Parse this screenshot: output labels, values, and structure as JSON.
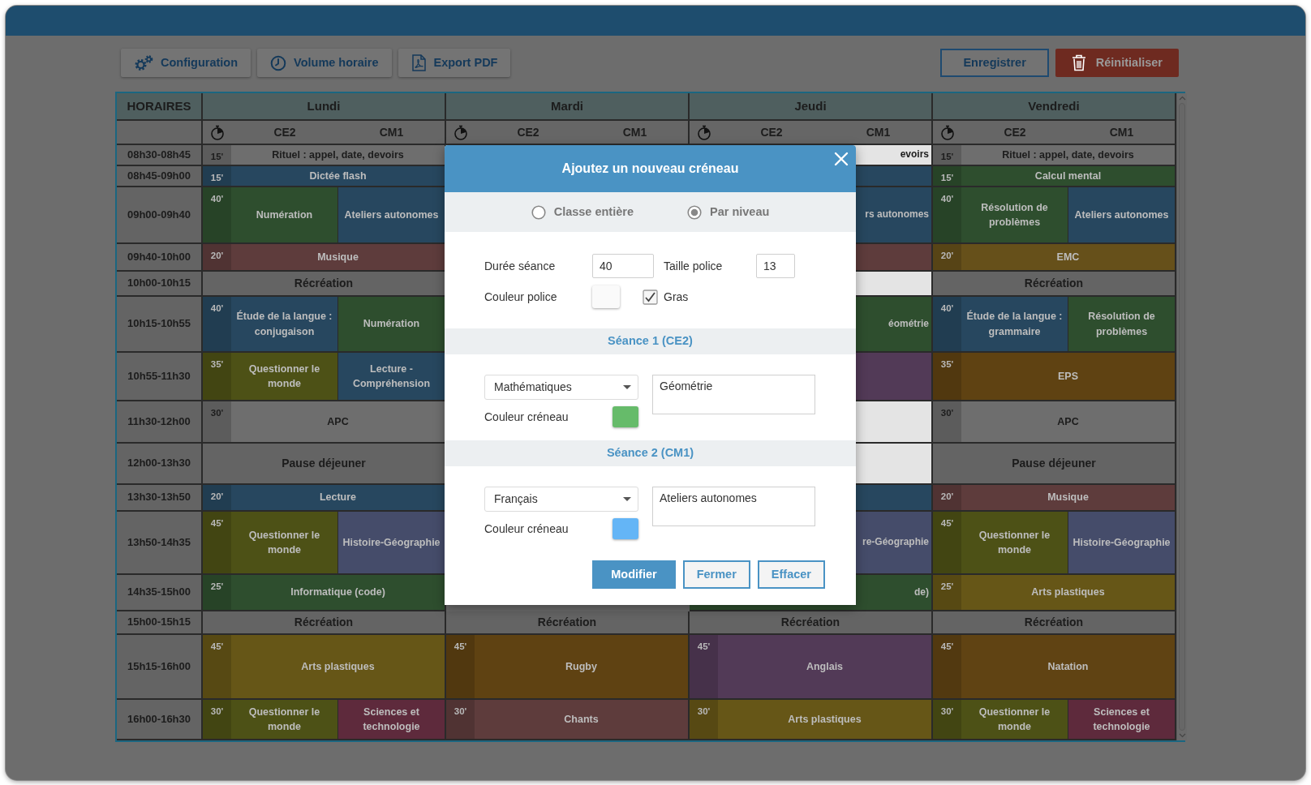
{
  "toolbar": {
    "buttons": [
      {
        "label": "Configuration"
      },
      {
        "label": "Volume horaire"
      },
      {
        "label": "Export PDF"
      }
    ],
    "save_button": "Enregistrer",
    "reset_button": "Réinitialiser"
  },
  "timetable": {
    "time_header": "HORAIRES",
    "days": [
      {
        "name": "Lundi",
        "groups": [
          "CE2",
          "CM1"
        ]
      },
      {
        "name": "Mardi",
        "groups": [
          "CE2",
          "CM1"
        ]
      },
      {
        "name": "Jeudi",
        "groups": [
          "CE2",
          "CM1"
        ]
      },
      {
        "name": "Vendredi",
        "groups": [
          "CE2",
          "CM1"
        ]
      }
    ],
    "rows": [
      {
        "time": "08h30-08h45",
        "cells": [
          {
            "kind": "slot",
            "duration": "15'",
            "label": "Rituel : appel, date, devoirs"
          },
          {
            "kind": "hidden"
          },
          {
            "kind": "clipped",
            "label": "evoirs"
          },
          {
            "kind": "slot",
            "duration": "15'",
            "label": "Rituel : appel, date, devoirs"
          }
        ]
      },
      {
        "time": "08h45-09h00",
        "cells": [
          {
            "kind": "slot",
            "duration": "15'",
            "label": "Dictée flash",
            "color": "#27475f"
          },
          {
            "kind": "hidden"
          },
          {
            "kind": "clipped",
            "color": "#27475f"
          },
          {
            "kind": "slot",
            "duration": "15'",
            "label": "Calcul mental",
            "color": "#2e4e2e"
          }
        ]
      },
      {
        "time": "09h00-09h40",
        "cells": [
          {
            "kind": "split",
            "duration": "40'",
            "left": {
              "label": "Numération",
              "color": "#2e4e2e"
            },
            "right": {
              "label": "Ateliers autonomes",
              "color": "#27475f"
            }
          },
          {
            "kind": "hidden"
          },
          {
            "kind": "clipped",
            "label": "rs autonomes",
            "color": "#27475f"
          },
          {
            "kind": "split",
            "duration": "40'",
            "left": {
              "label": "Résolution de problèmes",
              "color": "#2e4e2e"
            },
            "right": {
              "label": "Ateliers autonomes",
              "color": "#27475f"
            }
          }
        ]
      },
      {
        "time": "09h40-10h00",
        "cells": [
          {
            "kind": "slot",
            "duration": "20'",
            "label": "Musique",
            "color": "#5e3c3c"
          },
          {
            "kind": "hidden"
          },
          {
            "kind": "clipped",
            "color": "#5e3c3c"
          },
          {
            "kind": "slot",
            "duration": "20'",
            "label": "EMC",
            "color": "#66501a"
          }
        ]
      },
      {
        "time": "10h00-10h15",
        "cells": [
          {
            "kind": "break",
            "label": "Récréation"
          },
          {
            "kind": "hidden"
          },
          {
            "kind": "clipped"
          },
          {
            "kind": "break",
            "label": "Récréation"
          }
        ]
      },
      {
        "time": "10h15-10h55",
        "cells": [
          {
            "kind": "split",
            "duration": "40'",
            "left": {
              "label": "Étude de la langue : conjugaison",
              "color": "#27475f"
            },
            "right": {
              "label": "Numération",
              "color": "#2e4e2e"
            }
          },
          {
            "kind": "hidden"
          },
          {
            "kind": "clipped",
            "label": "éométrie",
            "color": "#2e4e2e"
          },
          {
            "kind": "split",
            "duration": "40'",
            "left": {
              "label": "Étude de la langue : grammaire",
              "color": "#27475f"
            },
            "right": {
              "label": "Résolution de problèmes",
              "color": "#2e4e2e"
            }
          }
        ]
      },
      {
        "time": "10h55-11h30",
        "cells": [
          {
            "kind": "split",
            "duration": "35'",
            "left": {
              "label": "Questionner le monde",
              "color": "#4d5116"
            },
            "right": {
              "label": "Lecture - Compréhension",
              "color": "#27475f"
            }
          },
          {
            "kind": "hidden"
          },
          {
            "kind": "clipped",
            "color": "#523a57"
          },
          {
            "kind": "slot",
            "duration": "35'",
            "label": "EPS",
            "color": "#5f4212"
          }
        ]
      },
      {
        "time": "11h30-12h00",
        "cells": [
          {
            "kind": "slot",
            "duration": "30'",
            "label": "APC"
          },
          {
            "kind": "hidden"
          },
          {
            "kind": "clipped"
          },
          {
            "kind": "slot",
            "duration": "30'",
            "label": "APC"
          }
        ]
      },
      {
        "time": "12h00-13h30",
        "cells": [
          {
            "kind": "break",
            "label": "Pause déjeuner"
          },
          {
            "kind": "hidden"
          },
          {
            "kind": "clipped"
          },
          {
            "kind": "break",
            "label": "Pause déjeuner"
          }
        ]
      },
      {
        "time": "13h30-13h50",
        "cells": [
          {
            "kind": "slot",
            "duration": "20'",
            "label": "Lecture",
            "color": "#27475f"
          },
          {
            "kind": "hidden"
          },
          {
            "kind": "clipped",
            "color": "#27475f"
          },
          {
            "kind": "slot",
            "duration": "20'",
            "label": "Musique",
            "color": "#5e3c3c"
          }
        ]
      },
      {
        "time": "13h50-14h35",
        "cells": [
          {
            "kind": "split",
            "duration": "45'",
            "left": {
              "label": "Questionner le monde",
              "color": "#4d5116"
            },
            "right": {
              "label": "Histoire-Géographie",
              "color": "#454c6a"
            }
          },
          {
            "kind": "hidden"
          },
          {
            "kind": "clipped",
            "label": "re-Géographie",
            "color": "#454c6a"
          },
          {
            "kind": "split",
            "duration": "45'",
            "left": {
              "label": "Questionner le monde",
              "color": "#4d5116"
            },
            "right": {
              "label": "Histoire-Géographie",
              "color": "#454c6a"
            }
          }
        ]
      },
      {
        "time": "14h35-15h00",
        "cells": [
          {
            "kind": "slot",
            "duration": "25'",
            "label": "Informatique (code)",
            "color": "#2e4e2e"
          },
          {
            "kind": "hidden"
          },
          {
            "kind": "clipped",
            "label": "de)",
            "color": "#2e4e2e"
          },
          {
            "kind": "slot",
            "duration": "25'",
            "label": "Arts plastiques",
            "color": "#665617"
          }
        ]
      },
      {
        "time": "15h00-15h15",
        "cells": [
          {
            "kind": "break",
            "label": "Récréation"
          },
          {
            "kind": "break",
            "label": "Récréation"
          },
          {
            "kind": "break",
            "label": "Récréation"
          },
          {
            "kind": "break",
            "label": "Récréation"
          }
        ]
      },
      {
        "time": "15h15-16h00",
        "cells": [
          {
            "kind": "slot",
            "duration": "45'",
            "label": "Arts plastiques",
            "color": "#665617"
          },
          {
            "kind": "slot",
            "duration": "45'",
            "label": "Rugby",
            "color": "#5f4212"
          },
          {
            "kind": "slot",
            "duration": "45'",
            "label": "Anglais",
            "color": "#523a57"
          },
          {
            "kind": "slot",
            "duration": "45'",
            "label": "Natation",
            "color": "#604313"
          }
        ]
      },
      {
        "time": "16h00-16h30",
        "cells": [
          {
            "kind": "split",
            "duration": "30'",
            "left": {
              "label": "Questionner le monde",
              "color": "#4d5116"
            },
            "right": {
              "label": "Sciences et technologie",
              "color": "#5e2a3c"
            }
          },
          {
            "kind": "slot",
            "duration": "30'",
            "label": "Chants",
            "color": "#5e3c3c"
          },
          {
            "kind": "slot",
            "duration": "30'",
            "label": "Arts plastiques",
            "color": "#665617"
          },
          {
            "kind": "split",
            "duration": "30'",
            "left": {
              "label": "Questionner le monde",
              "color": "#4d5116"
            },
            "right": {
              "label": "Sciences et technologie",
              "color": "#5e2a3c"
            }
          }
        ]
      }
    ]
  },
  "modal": {
    "title": "Ajoutez un nouveau créneau",
    "modes": [
      {
        "label": "Classe entière",
        "selected": false
      },
      {
        "label": "Par niveau",
        "selected": true
      }
    ],
    "duration": {
      "label": "Durée séance",
      "value": "40"
    },
    "font_size": {
      "label": "Taille police",
      "value": "13"
    },
    "font_color": {
      "label": "Couleur police",
      "color": "#fafafa"
    },
    "bold": {
      "label": "Gras",
      "checked": true
    },
    "sessions": [
      {
        "title": "Séance 1 (CE2)",
        "subject": "Mathématiques",
        "text": "Géométrie",
        "color_label": "Couleur créneau",
        "color": "#66bb6a"
      },
      {
        "title": "Séance 2 (CM1)",
        "subject": "Français",
        "text": "Ateliers autonomes",
        "color_label": "Couleur créneau",
        "color": "#64b5f6"
      }
    ],
    "buttons": [
      {
        "label": "Modifier",
        "primary": true
      },
      {
        "label": "Fermer",
        "primary": false
      },
      {
        "label": "Effacer",
        "primary": false
      }
    ]
  }
}
